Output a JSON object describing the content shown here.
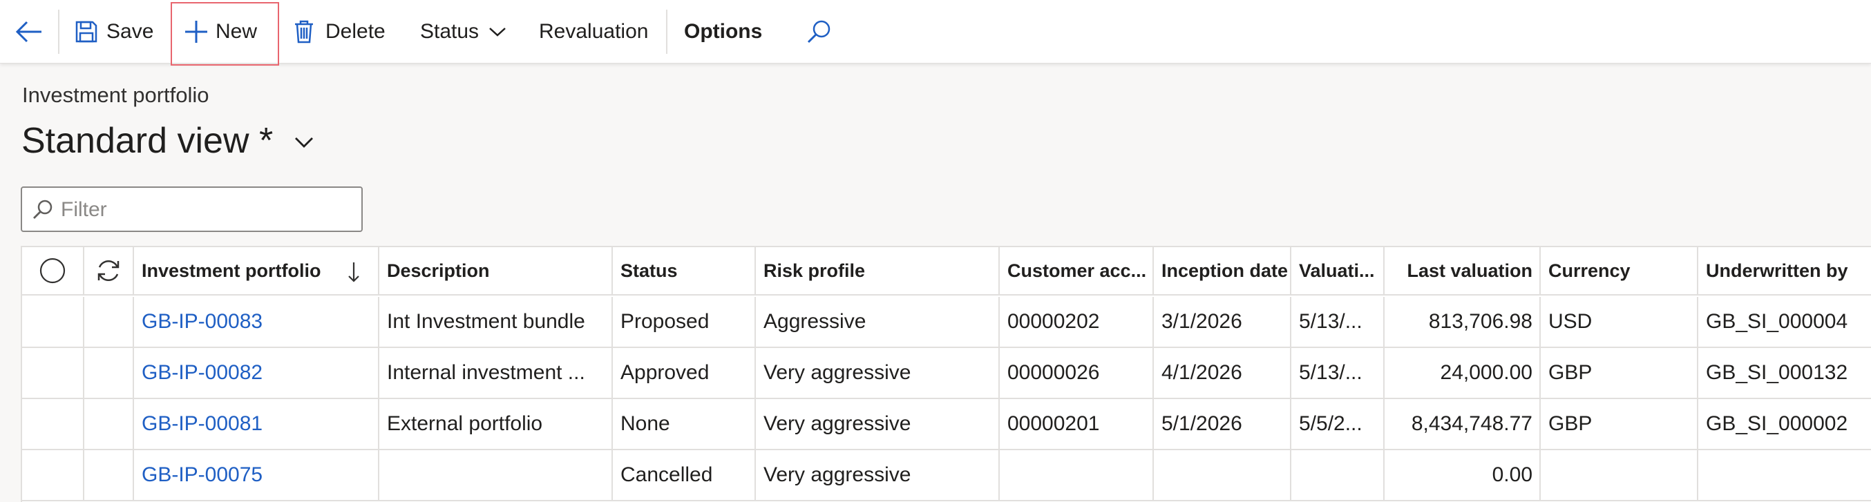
{
  "toolbar": {
    "save_label": "Save",
    "new_label": "New",
    "delete_label": "Delete",
    "status_label": "Status",
    "revaluation_label": "Revaluation",
    "options_label": "Options"
  },
  "page": {
    "subtitle": "Investment portfolio",
    "view_name": "Standard view *"
  },
  "filter": {
    "placeholder": "Filter"
  },
  "columns": {
    "investment_portfolio": "Investment portfolio",
    "description": "Description",
    "status": "Status",
    "risk_profile": "Risk profile",
    "customer_account": "Customer acc...",
    "inception_date": "Inception date",
    "valuation": "Valuati...",
    "last_valuation": "Last valuation",
    "currency": "Currency",
    "underwritten_by": "Underwritten by"
  },
  "rows": [
    {
      "portfolio": "GB-IP-00083",
      "description": "Int Investment bundle",
      "status": "Proposed",
      "risk": "Aggressive",
      "customer": "00000202",
      "inception": "3/1/2026",
      "valuation": "5/13/...",
      "last_valuation": "813,706.98",
      "currency": "USD",
      "underwritten": "GB_SI_000004"
    },
    {
      "portfolio": "GB-IP-00082",
      "description": "Internal investment ...",
      "status": "Approved",
      "risk": "Very aggressive",
      "customer": "00000026",
      "inception": "4/1/2026",
      "valuation": "5/13/...",
      "last_valuation": "24,000.00",
      "currency": "GBP",
      "underwritten": "GB_SI_000132"
    },
    {
      "portfolio": "GB-IP-00081",
      "description": "External portfolio",
      "status": "None",
      "risk": "Very aggressive",
      "customer": "00000201",
      "inception": "5/1/2026",
      "valuation": "5/5/2...",
      "last_valuation": "8,434,748.77",
      "currency": "GBP",
      "underwritten": "GB_SI_000002"
    },
    {
      "portfolio": "GB-IP-00075",
      "description": "",
      "status": "Cancelled",
      "risk": "Very aggressive",
      "customer": "",
      "inception": "",
      "valuation": "",
      "last_valuation": "0.00",
      "currency": "",
      "underwritten": ""
    }
  ],
  "colors": {
    "accent": "#1f5fc4",
    "highlight_border": "#e8656e"
  }
}
